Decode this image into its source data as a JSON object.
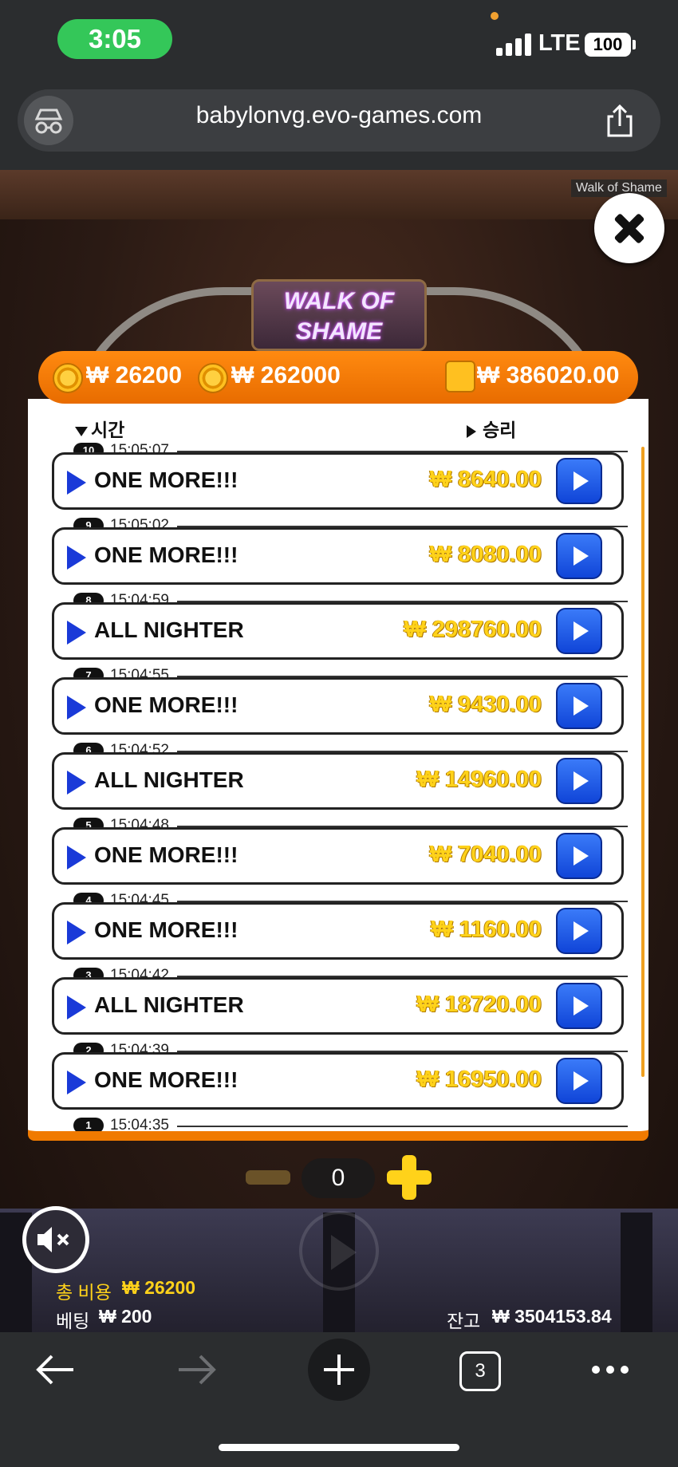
{
  "status_bar": {
    "time": "3:05",
    "network": "LTE",
    "battery": "100"
  },
  "browser": {
    "url": "babylonvg.evo-games.com",
    "tabs_count": "3"
  },
  "game": {
    "tag": "Walk of Shame",
    "logo": {
      "line1": "WALK OF",
      "line2": "SHAME"
    },
    "header": {
      "currency": "₩",
      "total_cost": "₩ 26200",
      "total_bet": "₩ 262000",
      "winnings": "₩ 386020.00"
    },
    "columns": {
      "time": "시간",
      "win": "승리"
    },
    "rounds": [
      {
        "num": "10",
        "time": "15:05:07",
        "label": "ONE MORE!!!",
        "amount": "₩ 8640.00"
      },
      {
        "num": "9",
        "time": "15:05:02",
        "label": "ONE MORE!!!",
        "amount": "₩ 8080.00"
      },
      {
        "num": "8",
        "time": "15:04:59",
        "label": "ALL NIGHTER",
        "amount": "₩ 298760.00"
      },
      {
        "num": "7",
        "time": "15:04:55",
        "label": "ONE MORE!!!",
        "amount": "₩ 9430.00"
      },
      {
        "num": "6",
        "time": "15:04:52",
        "label": "ALL NIGHTER",
        "amount": "₩ 14960.00"
      },
      {
        "num": "5",
        "time": "15:04:48",
        "label": "ONE MORE!!!",
        "amount": "₩ 7040.00"
      },
      {
        "num": "4",
        "time": "15:04:45",
        "label": "ONE MORE!!!",
        "amount": "₩ 1160.00"
      },
      {
        "num": "3",
        "time": "15:04:42",
        "label": "ALL NIGHTER",
        "amount": "₩ 18720.00"
      },
      {
        "num": "2",
        "time": "15:04:39",
        "label": "ONE MORE!!!",
        "amount": "₩ 16950.00"
      },
      {
        "num": "1",
        "time": "15:04:35",
        "label": "",
        "amount": ""
      }
    ],
    "stepper_value": "0",
    "footer": {
      "total_cost_label": "총 비용",
      "total_cost_value": "₩ 26200",
      "bet_label": "베팅",
      "bet_value": "₩ 200",
      "balance_label": "잔고",
      "balance_value": "₩ 3504153.84"
    }
  },
  "colors": {
    "accent_orange": "#f07a00",
    "gold": "#ffd21a",
    "play_blue": "#1a3ad8"
  }
}
